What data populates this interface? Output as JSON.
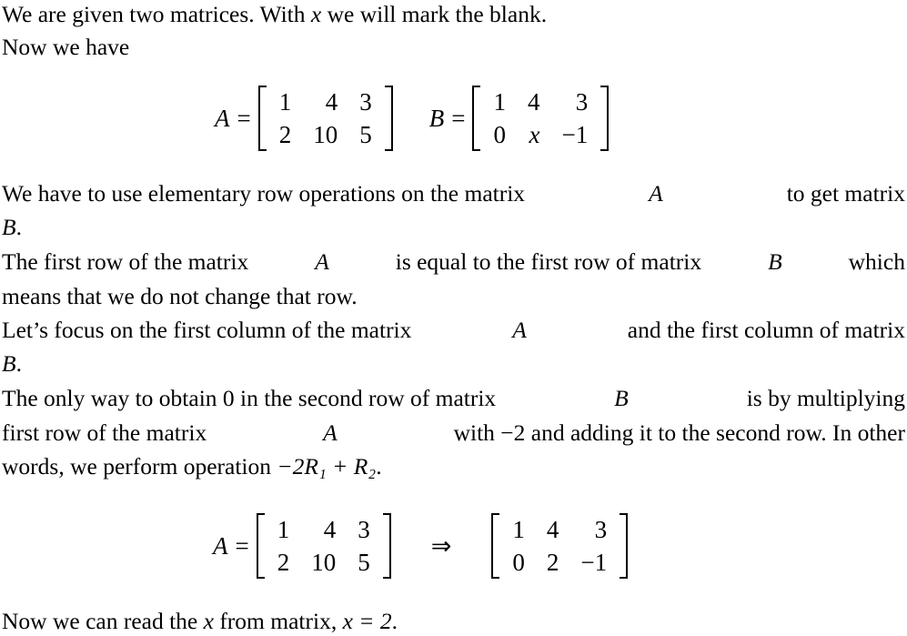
{
  "paragraphs": {
    "p1": "We are given two matrices. With",
    "p1_var": "x",
    "p1_end": "we will mark the blank.",
    "p2": "Now we have",
    "p3a": "We have to use elementary row operations on the matrix",
    "p3_varA": "A",
    "p3b": "to get matrix",
    "p3_varB": "B",
    "p3_end": ".",
    "p4a": "The first row of the matrix",
    "p4_varA": "A",
    "p4b": "is equal to the first row of matrix",
    "p4_varB": "B",
    "p4c": "which",
    "p4d": "means that we do not change that row.",
    "p5a": "Let’s focus on the first column of the matrix",
    "p5_varA": "A",
    "p5b": "and the first column of matrix",
    "p5_varB": "B",
    "p5_end": ".",
    "p6a": "The only way to obtain 0 in the second row of matrix",
    "p6_varB": "B",
    "p6b": "is by multiplying",
    "p6c": "first row of the matrix",
    "p6_varA": "A",
    "p6d": "with −2 and adding it to the second row. In other",
    "p6e": "words, we perform operation",
    "p6_op": "−2R₁ + R₂",
    "p6_end": ".",
    "p7a": "Now we can read the",
    "p7_var": "x",
    "p7b": "from matrix,",
    "p7_ans": "x = 2",
    "p7_end": "."
  },
  "equation1": {
    "matrixA": {
      "label": "A",
      "rows": [
        [
          "1",
          "4",
          "3"
        ],
        [
          "2",
          "10",
          "5"
        ]
      ]
    },
    "matrixB": {
      "label": "B",
      "rows": [
        [
          "1",
          "4",
          "3"
        ],
        [
          "0",
          "x",
          "−1"
        ]
      ]
    },
    "equals": "="
  },
  "equation2": {
    "matrixA": {
      "label": "A",
      "rows": [
        [
          "1",
          "4",
          "3"
        ],
        [
          "2",
          "10",
          "5"
        ]
      ]
    },
    "arrow": "⇒",
    "result": {
      "rows": [
        [
          "1",
          "4",
          "3"
        ],
        [
          "0",
          "2",
          "−1"
        ]
      ]
    },
    "equals": "="
  }
}
